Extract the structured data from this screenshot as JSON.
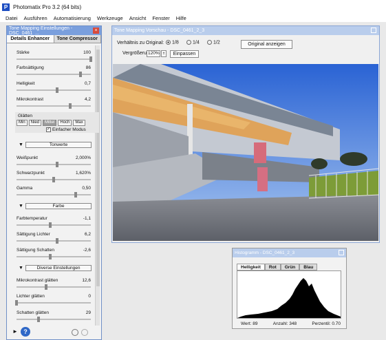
{
  "app": {
    "title": "Photomatix Pro 3.2 (64 bits)"
  },
  "menu": [
    "Datei",
    "Ausführen",
    "Automatisierung",
    "Werkzeuge",
    "Ansicht",
    "Fenster",
    "Hilfe"
  ],
  "tool_panel": {
    "title": "Tone Mapping Einstellungen - DSC_0461_...",
    "tabs": [
      "Details Enhancer",
      "Tone Compressor"
    ],
    "sliders": [
      {
        "label": "Stärke",
        "value": "100",
        "level": 1.0
      },
      {
        "label": "Farbsättigung",
        "value": "86",
        "level": 0.86
      },
      {
        "label": "Helligkeit",
        "value": "0,7",
        "level": 0.55
      },
      {
        "label": "Mikrokontrast",
        "value": "4,2",
        "level": 0.72
      }
    ],
    "glaetten": {
      "label": "Glätten",
      "buttons": [
        "Min",
        "Nied",
        "Mittel",
        "Hoch",
        "Max"
      ],
      "active": "Mittel",
      "checkbox_label": "Einfacher Modus",
      "checked": true
    },
    "tonwerte": {
      "header": "Tonwerte",
      "sliders": [
        {
          "label": "Weißpunkt",
          "value": "2,000%",
          "level": 0.55
        },
        {
          "label": "Schwarzpunkt",
          "value": "1,620%",
          "level": 0.5
        },
        {
          "label": "Gamma",
          "value": "0,50",
          "level": 0.8
        }
      ]
    },
    "farbe": {
      "header": "Farbe",
      "sliders": [
        {
          "label": "Farbtemperatur",
          "value": "-1,1",
          "level": 0.45
        },
        {
          "label": "Sättigung Lichter",
          "value": "6,2",
          "level": 0.55
        },
        {
          "label": "Sättigung Schatten",
          "value": "-2,6",
          "level": 0.45
        }
      ]
    },
    "diverse": {
      "header": "Diverse Einstellungen",
      "sliders": [
        {
          "label": "Mikrokontrast glätten",
          "value": "12,6",
          "level": 0.4
        },
        {
          "label": "Lichter glätten",
          "value": "0",
          "level": 0.0
        },
        {
          "label": "Schatten glätten",
          "value": "29",
          "level": 0.3
        }
      ]
    }
  },
  "preview": {
    "title": "Tone Mapping Vorschau - DSC_0461_2_3",
    "ratio_label": "Verhältnis zu Original:",
    "ratio_options": [
      "1/8",
      "1/4",
      "1/2"
    ],
    "ratio_selected": "1/8",
    "zoom_label": "Vergrößerung:",
    "zoom_value": "120%",
    "fit_button": "Einpassen",
    "original_button": "Original anzeigen"
  },
  "histogram": {
    "title": "Histogramm - DSC_0461_2_3",
    "tabs": [
      "Helligkeit",
      "Rot",
      "Grün",
      "Blau"
    ],
    "active_tab": "Helligkeit",
    "status": {
      "wert": "Wert: 89",
      "anzahl": "Anzahl: 348",
      "perzentil": "Perzentil: 0.70"
    }
  },
  "colors": {
    "accent": "#7a9fdd",
    "header_inactive": "#b9cdec",
    "close": "#d84a3b"
  },
  "icons": [
    "help-icon"
  ]
}
